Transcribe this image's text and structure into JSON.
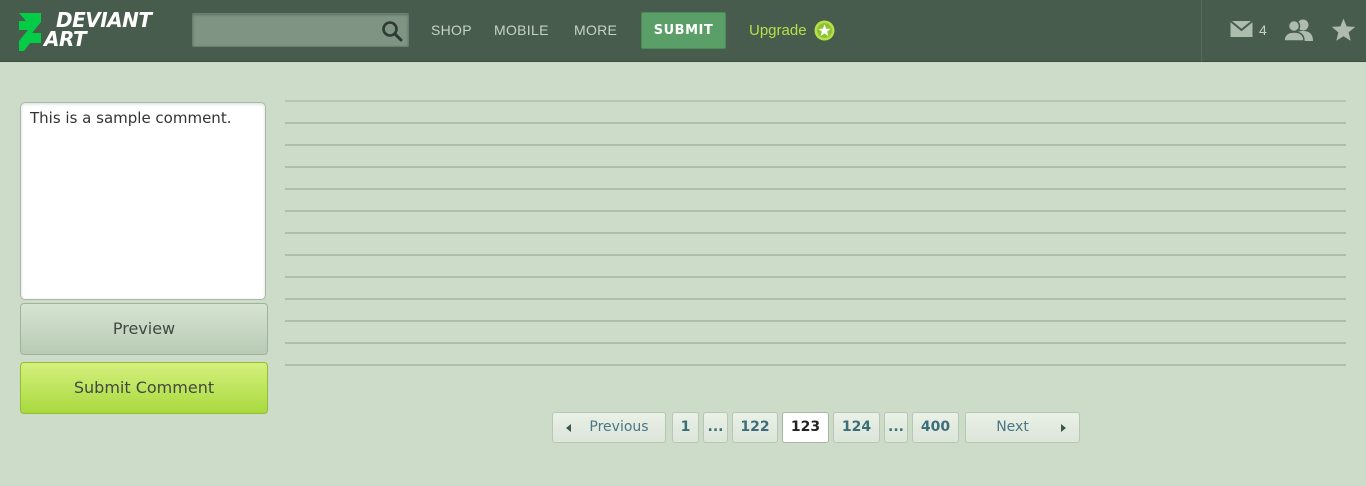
{
  "header": {
    "logo_line1": "DEVIANT",
    "logo_line2": "ART",
    "search": {
      "value": "",
      "placeholder": ""
    },
    "nav": [
      "SHOP",
      "MOBILE",
      "MORE"
    ],
    "submit_label": "SUBMIT",
    "upgrade_label": "Upgrade",
    "mail_count": "4",
    "icons": [
      "search-icon",
      "upgrade-star-icon",
      "mail-icon",
      "friends-icon",
      "star-icon"
    ],
    "colors": {
      "bar": "#475c4d",
      "submit": "#5a9e68",
      "upgrade": "#b6e04b",
      "logo_mark": "#05cc47"
    }
  },
  "comment": {
    "text": "This is a sample comment.",
    "preview_label": "Preview",
    "submit_label": "Submit Comment"
  },
  "pagination": {
    "previous": "Previous",
    "next": "Next",
    "pages": [
      "1",
      "...",
      "122",
      "123",
      "124",
      "...",
      "400"
    ],
    "current": "123"
  }
}
